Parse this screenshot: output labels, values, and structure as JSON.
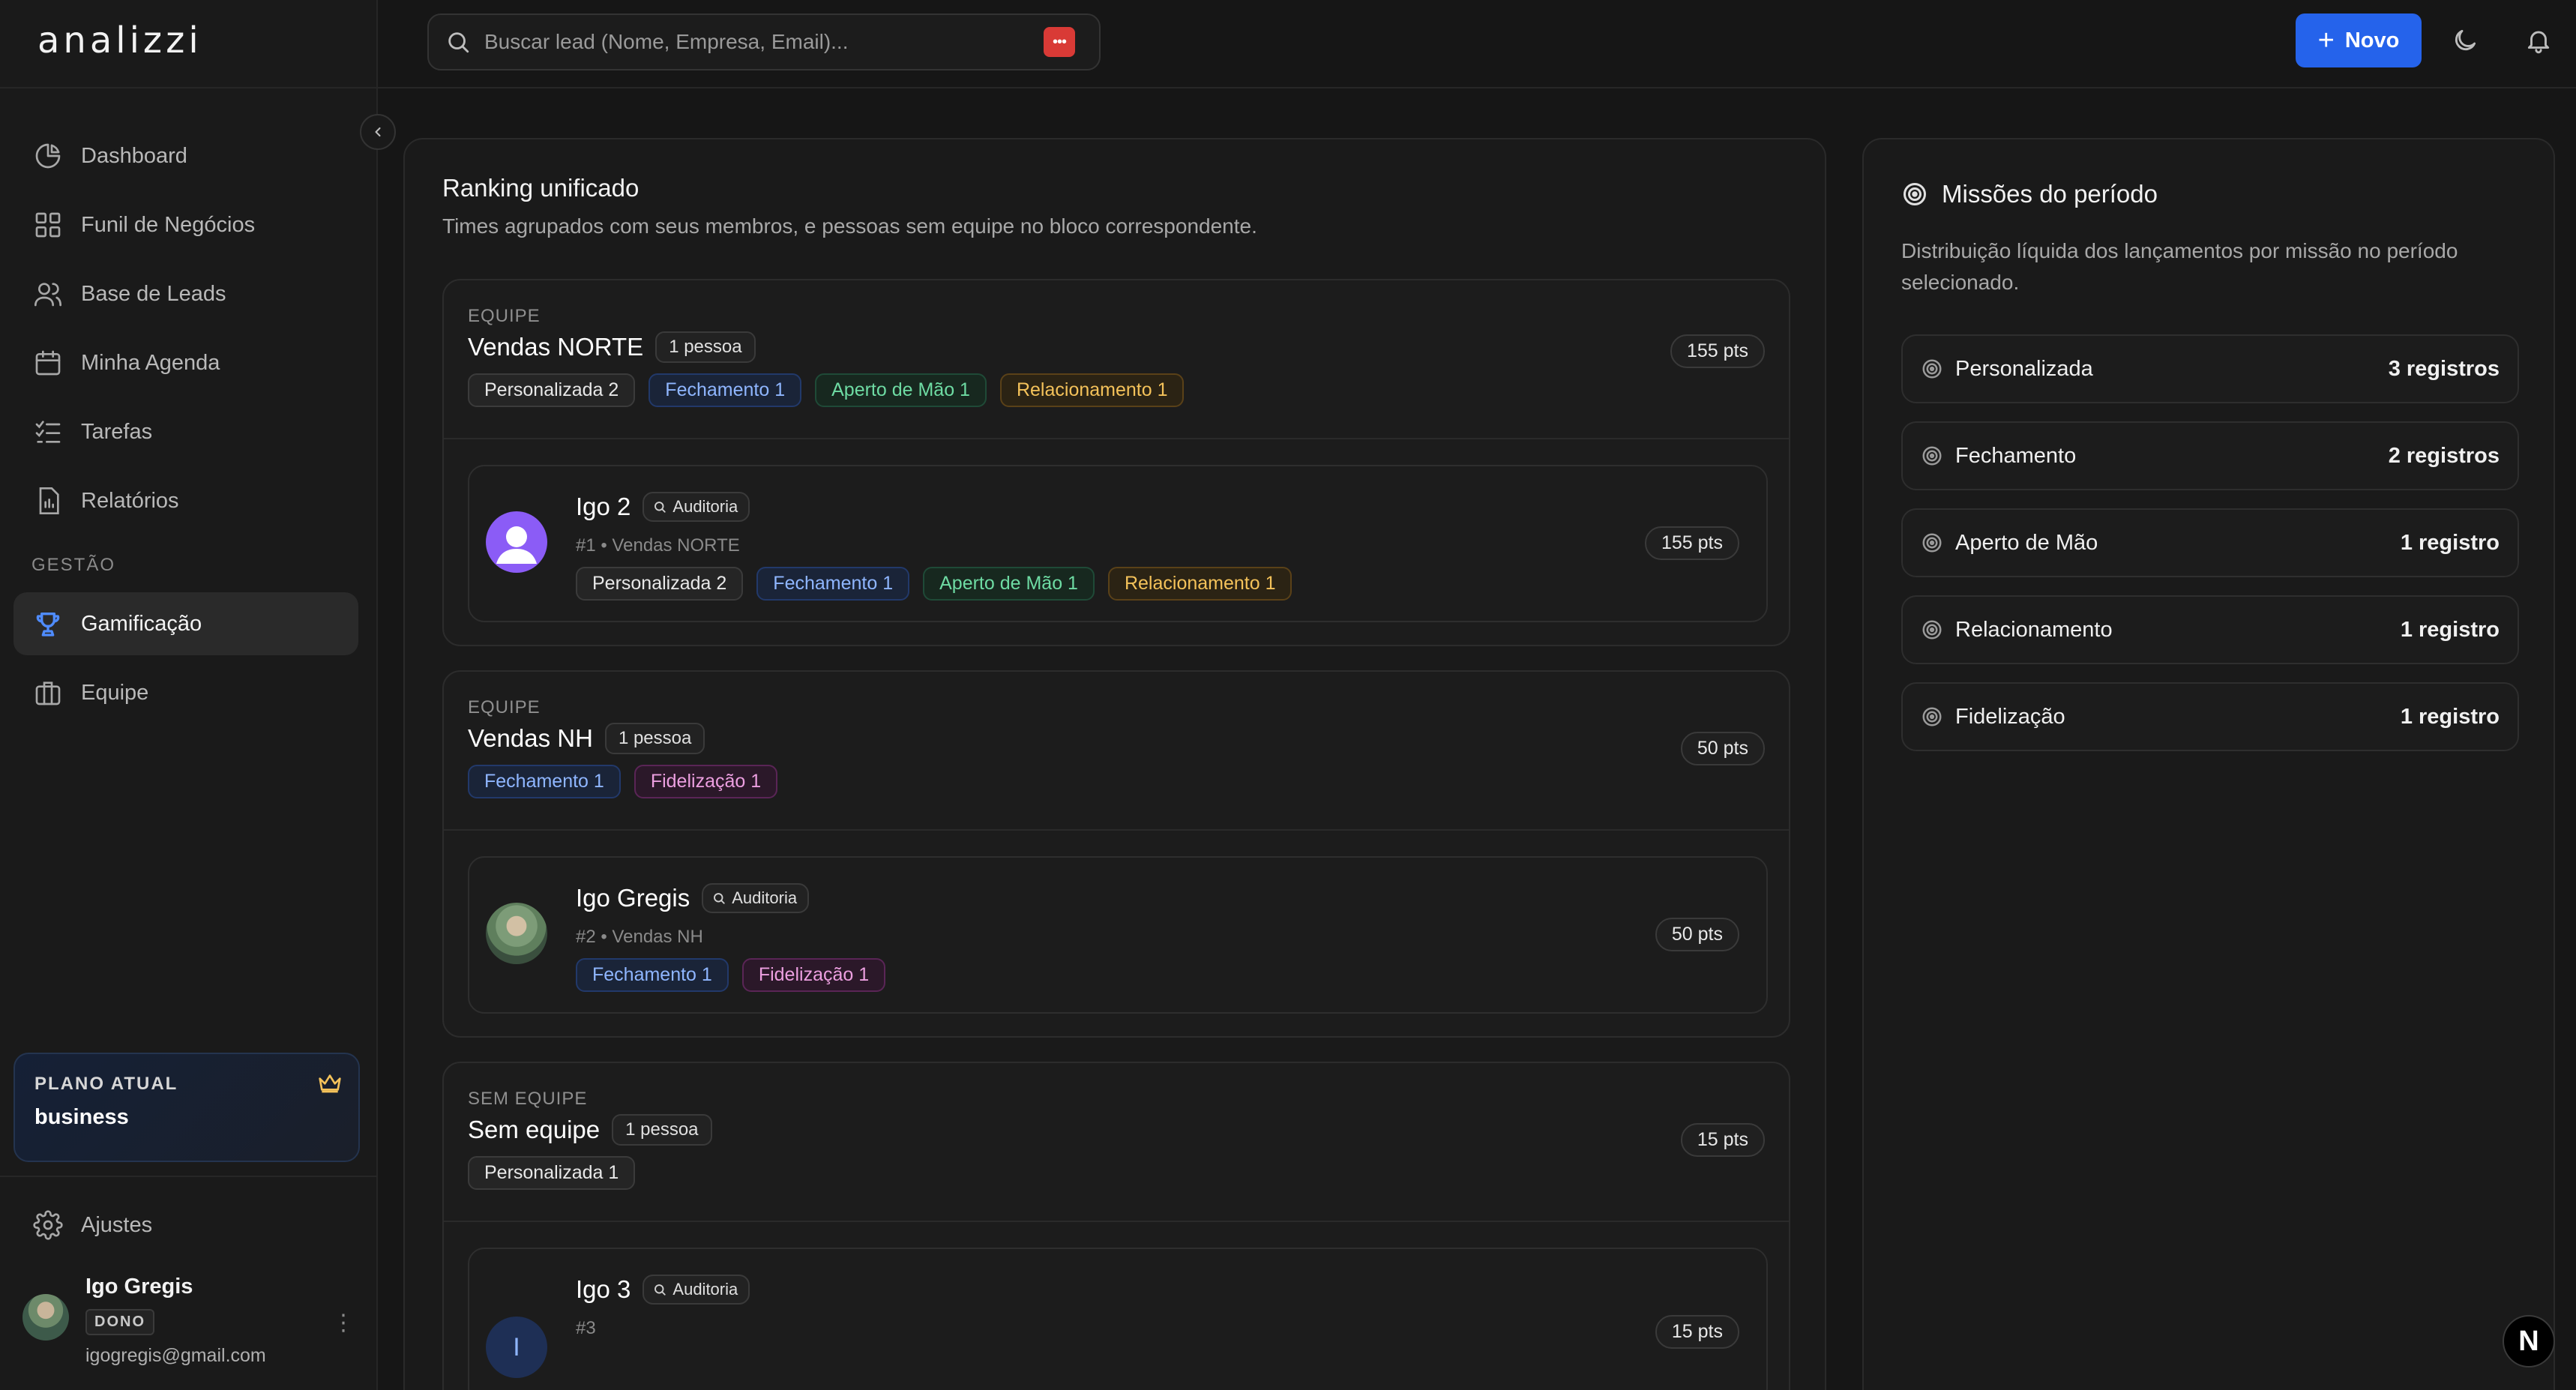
{
  "app": {
    "logo": "analizzi"
  },
  "sidebar": {
    "items": [
      {
        "label": "Dashboard",
        "icon": "pie-chart-icon"
      },
      {
        "label": "Funil de Negócios",
        "icon": "grid-icon"
      },
      {
        "label": "Base de Leads",
        "icon": "users-icon"
      },
      {
        "label": "Minha Agenda",
        "icon": "calendar-icon"
      },
      {
        "label": "Tarefas",
        "icon": "checklist-icon"
      },
      {
        "label": "Relatórios",
        "icon": "report-icon"
      }
    ],
    "section_label": "GESTÃO",
    "gestao_items": [
      {
        "label": "Gamificação",
        "icon": "trophy-icon",
        "active": true
      },
      {
        "label": "Equipe",
        "icon": "briefcase-icon"
      }
    ],
    "plan": {
      "label": "PLANO ATUAL",
      "name": "business"
    },
    "settings_label": "Ajustes",
    "user": {
      "name": "Igo Gregis",
      "role": "DONO",
      "email": "igogregis@gmail.com"
    }
  },
  "header": {
    "search_placeholder": "Buscar lead (Nome, Empresa, Email)...",
    "new_button": "Novo"
  },
  "ranking": {
    "title": "Ranking unificado",
    "subtitle": "Times agrupados com seus membros, e pessoas sem equipe no bloco correspondente.",
    "groups": [
      {
        "label": "EQUIPE",
        "name": "Vendas NORTE",
        "count": "1 pessoa",
        "points": "155 pts",
        "tags": [
          "Personalizada 2",
          "Fechamento 1",
          "Aperto de Mão 1",
          "Relacionamento 1"
        ],
        "member": {
          "name": "Igo 2",
          "audit": "Auditoria",
          "meta": "#1 • Vendas NORTE",
          "points": "155 pts",
          "tags": [
            "Personalizada 2",
            "Fechamento 1",
            "Aperto de Mão 1",
            "Relacionamento 1"
          ]
        }
      },
      {
        "label": "EQUIPE",
        "name": "Vendas NH",
        "count": "1 pessoa",
        "points": "50 pts",
        "tags": [
          "Fechamento 1",
          "Fidelização 1"
        ],
        "member": {
          "name": "Igo Gregis",
          "audit": "Auditoria",
          "meta": "#2 • Vendas NH",
          "points": "50 pts",
          "tags": [
            "Fechamento 1",
            "Fidelização 1"
          ]
        }
      },
      {
        "label": "SEM EQUIPE",
        "name": "Sem equipe",
        "count": "1 pessoa",
        "points": "15 pts",
        "tags": [
          "Personalizada 1"
        ],
        "member": {
          "name": "Igo 3",
          "audit": "Auditoria",
          "meta": "#3",
          "points": "15 pts",
          "initial": "I"
        }
      }
    ]
  },
  "missions": {
    "title": "Missões do período",
    "subtitle": "Distribuição líquida dos lançamentos por missão no período selecionado.",
    "items": [
      {
        "name": "Personalizada",
        "count": "3 registros"
      },
      {
        "name": "Fechamento",
        "count": "2 registros"
      },
      {
        "name": "Aperto de Mão",
        "count": "1 registro"
      },
      {
        "name": "Relacionamento",
        "count": "1 registro"
      },
      {
        "name": "Fidelização",
        "count": "1 registro"
      }
    ]
  },
  "colors": {
    "accent": "#2563eb",
    "fechamento": "#8fb6ff",
    "aperto": "#6edba3",
    "relacionamento": "#f4c25a",
    "fidelizacao": "#ec9fe0"
  }
}
